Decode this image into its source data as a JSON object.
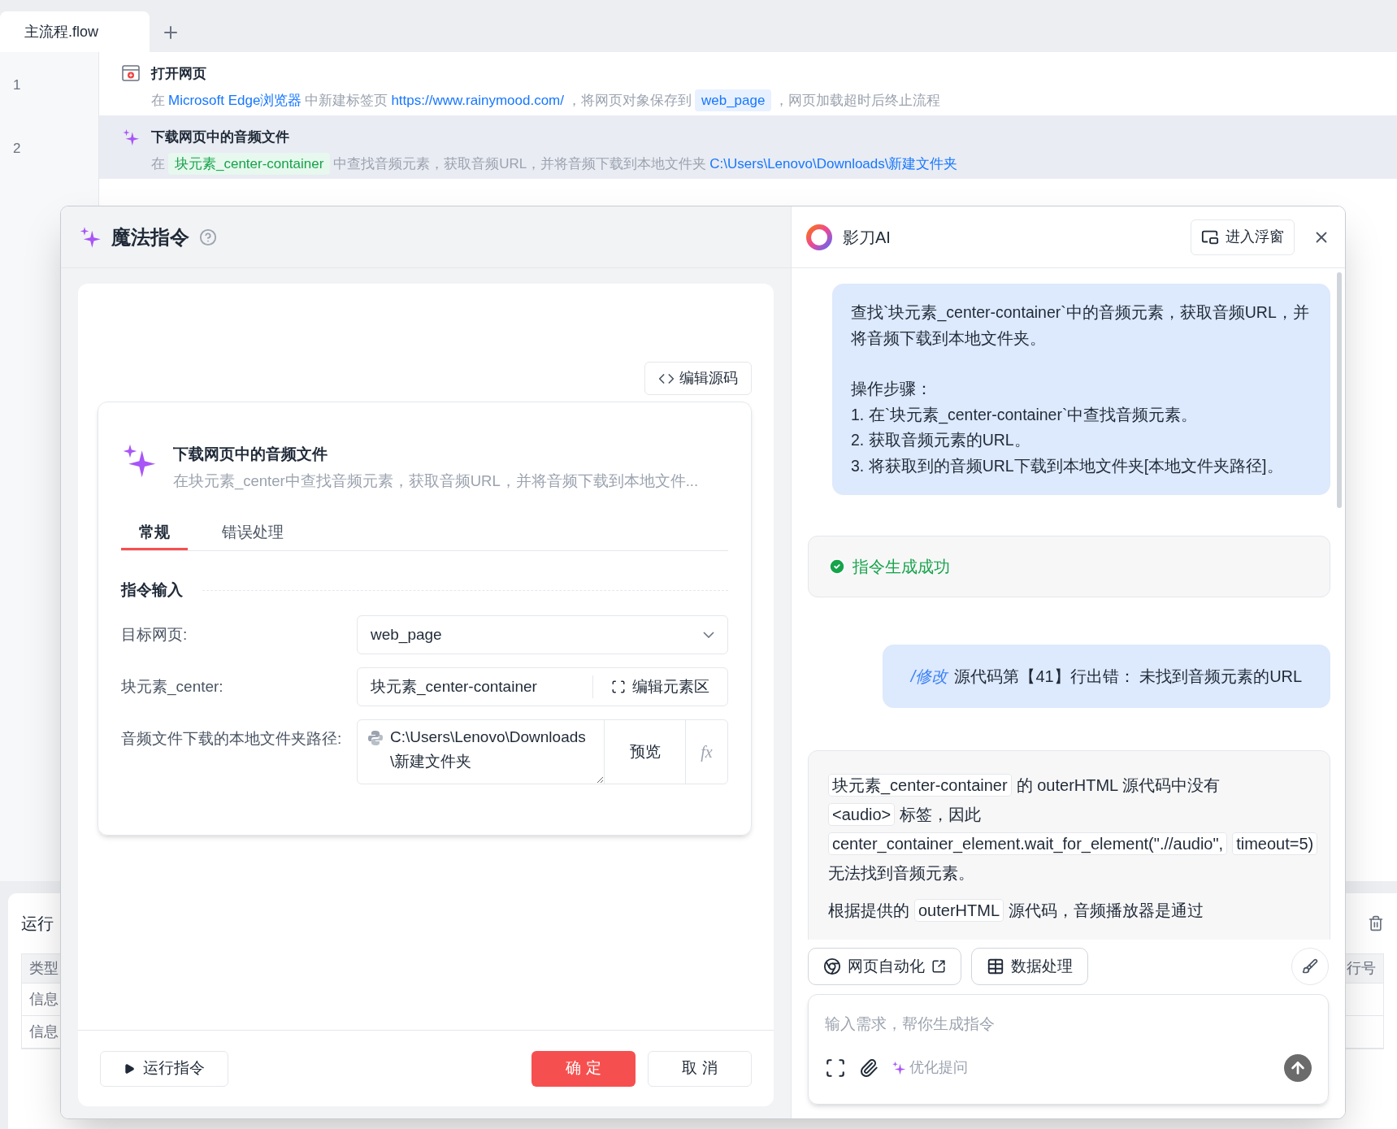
{
  "tabs": [
    {
      "label": "主流程.flow",
      "selected": true
    }
  ],
  "flow": {
    "steps": [
      {
        "line": "1",
        "kind": "browser",
        "title": "打开网页",
        "selected": false,
        "description": [
          {
            "kind": "text",
            "text": "在"
          },
          {
            "kind": "link",
            "text": "Microsoft Edge浏览器"
          },
          {
            "kind": "text",
            "text": "中新建标签页"
          },
          {
            "kind": "link",
            "text": "https://www.rainymood.com/"
          },
          {
            "kind": "text",
            "text": "，将网页对象保存到"
          },
          {
            "kind": "variable",
            "text": "web_page"
          },
          {
            "kind": "text",
            "text": "，网页加载超时后终止流程"
          }
        ]
      },
      {
        "line": "2",
        "kind": "magic",
        "title": "下载网页中的音频文件",
        "selected": true,
        "description": [
          {
            "kind": "text",
            "text": "在"
          },
          {
            "kind": "element",
            "text": "块元素_center-container"
          },
          {
            "kind": "text",
            "text": "中查找音频元素，获取音频URL，并将音频下载到本地文件夹"
          },
          {
            "kind": "link",
            "text": "C:\\Users\\Lenovo\\Downloads\\新建文件夹"
          }
        ]
      }
    ]
  },
  "log_panel": {
    "title": "运行",
    "columns": [
      "类型",
      "行号"
    ],
    "rows": [
      {
        "type": "信息"
      },
      {
        "type": "信息"
      }
    ]
  },
  "dialog": {
    "title": "魔法指令",
    "edit_source_button": "编辑源码",
    "command": {
      "title": "下载网页中的音频文件",
      "description": "在块元素_center中查找音频元素，获取音频URL，并将音频下载到本地文件..."
    },
    "tabs": [
      {
        "label": "常规",
        "selected": true
      },
      {
        "label": "错误处理",
        "selected": false
      }
    ],
    "section": "指令输入",
    "fields": [
      {
        "kind": "select",
        "label": "目标网页:",
        "value": "web_page"
      },
      {
        "kind": "element",
        "label": "块元素_center:",
        "value": "块元素_center-container",
        "action": "编辑元素区"
      },
      {
        "kind": "path",
        "label": "音频文件下载的本地文件夹路径:",
        "value": "C:\\Users\\Lenovo\\Downloads\\新建文件夹",
        "action": "预览",
        "formula": "fx"
      }
    ],
    "run_button": "运行指令",
    "ok_button": "确 定",
    "cancel_button": "取 消"
  },
  "assistant": {
    "title": "影刀AI",
    "float_button": "进入浮窗",
    "messages": [
      {
        "kind": "request",
        "intro": "查找`块元素_center-container`中的音频元素，获取音频URL，并将音频下载到本地文件夹。",
        "steps": [
          "操作步骤：",
          "1. 在`块元素_center-container`中查找音频元素。",
          "2. 获取音频元素的URL。",
          "3. 将获取到的音频URL下载到本地文件夹[本地文件夹路径]。"
        ]
      },
      {
        "kind": "success",
        "text": "指令生成成功"
      },
      {
        "kind": "command",
        "command": "/修改",
        "text": "源代码第【41】行出错： 未找到音频元素的URL"
      },
      {
        "kind": "answer",
        "paragraphs": [
          [
            {
              "kind": "code",
              "text": "块元素_center-container"
            },
            {
              "kind": "text",
              "text": "的 outerHTML 源代码中没有"
            },
            {
              "kind": "code",
              "text": "<audio>"
            },
            {
              "kind": "text",
              "text": "标签，因此"
            },
            {
              "kind": "code",
              "text": "center_container_element.wait_for_element(\".//audio\","
            },
            {
              "kind": "code",
              "text": "timeout=5)"
            },
            {
              "kind": "text",
              "text": "无法找到音频元素。"
            }
          ],
          [
            {
              "kind": "text",
              "text": "根据提供的"
            },
            {
              "kind": "code",
              "text": "outerHTML"
            },
            {
              "kind": "text",
              "text": "源代码，音频播放器是通过"
            }
          ]
        ]
      }
    ],
    "chips": [
      {
        "kind": "web",
        "label": "网页自动化"
      },
      {
        "kind": "data",
        "label": "数据处理"
      }
    ],
    "input": {
      "placeholder": "输入需求，帮你生成指令"
    },
    "optimize_button": "优化提问"
  }
}
